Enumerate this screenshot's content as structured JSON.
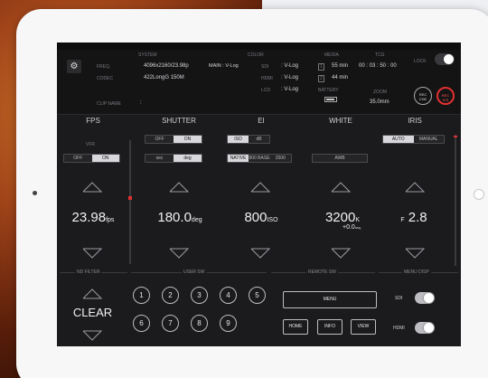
{
  "system": {
    "label": "SYSTEM",
    "freq_label": "FREQ.",
    "freq_value": "4096x2160/23.98p",
    "codec_label": "CODEC",
    "codec_value": "422LongG 150M",
    "clip_label": "CLIP NAME",
    "clip_value": ":"
  },
  "color": {
    "label": "COLOR",
    "main_label": "MAIN : V-Log",
    "sdi_label": "SDI",
    "sdi_value": ": V-Log",
    "hdmi_label": "HDMI",
    "hdmi_value": ": V-Log",
    "lcd_label": "LCD",
    "lcd_value": ": V-Log"
  },
  "media": {
    "label": "MEDIA",
    "slot1_label": "1",
    "slot1_value": "55 min",
    "slot2_label": "2",
    "slot2_value": "44 min",
    "battery_label": "BATTERY"
  },
  "tc": {
    "label": "TCG",
    "value": "00 : 03 : 50 : 00"
  },
  "lock": {
    "label": "LOCK",
    "state": "off"
  },
  "zoom": {
    "label": "ZOOM",
    "value": "35.0mm"
  },
  "rec_chk": {
    "line1": "REC",
    "line2": "CHK"
  },
  "rec_ss": {
    "line1": "REC",
    "line2": "S/S"
  },
  "columns": {
    "fps": {
      "title": "FPS",
      "vfr_label": "VFR",
      "seg": [
        "OFF",
        "ON"
      ],
      "active": 1,
      "value": "23.98",
      "unit": "fps"
    },
    "shutter": {
      "title": "SHUTTER",
      "seg1": [
        "OFF",
        "ON"
      ],
      "seg1_active": 1,
      "seg2": [
        "sec",
        "deg"
      ],
      "seg2_active": 1,
      "value": "180.0",
      "unit": "deg"
    },
    "ei": {
      "title": "EI",
      "seg1": [
        "ISO",
        "dB"
      ],
      "seg1_active": 0,
      "seg2": [
        "NATIVE",
        "800 BASE",
        "2500 BASE"
      ],
      "seg2_active": 0,
      "value": "800",
      "unit": "ISO"
    },
    "white": {
      "title": "WHITE",
      "awb": "AWB",
      "value": "3200",
      "unit": "K",
      "sub": "+0.0",
      "sub_unit": "GMg"
    },
    "iris": {
      "title": "IRIS",
      "seg": [
        "AUTO",
        "MANUAL"
      ],
      "active": 0,
      "prefix": "F",
      "value": "2.8"
    }
  },
  "sections": {
    "nd": "ND FILTER",
    "user": "USER SW",
    "remote": "REMOTE SW",
    "menu": "MENU DISP"
  },
  "nd_value": "CLEAR",
  "user_buttons": [
    "1",
    "2",
    "3",
    "4",
    "5",
    "6",
    "7",
    "8",
    "9"
  ],
  "remote": {
    "menu": "MENU",
    "home": "HOME",
    "info": "INFO",
    "view": "VIEW"
  },
  "menu_disp": {
    "sdi": "SDI",
    "sdi_state": "on",
    "hdmi": "HDMI",
    "hdmi_state": "on"
  }
}
